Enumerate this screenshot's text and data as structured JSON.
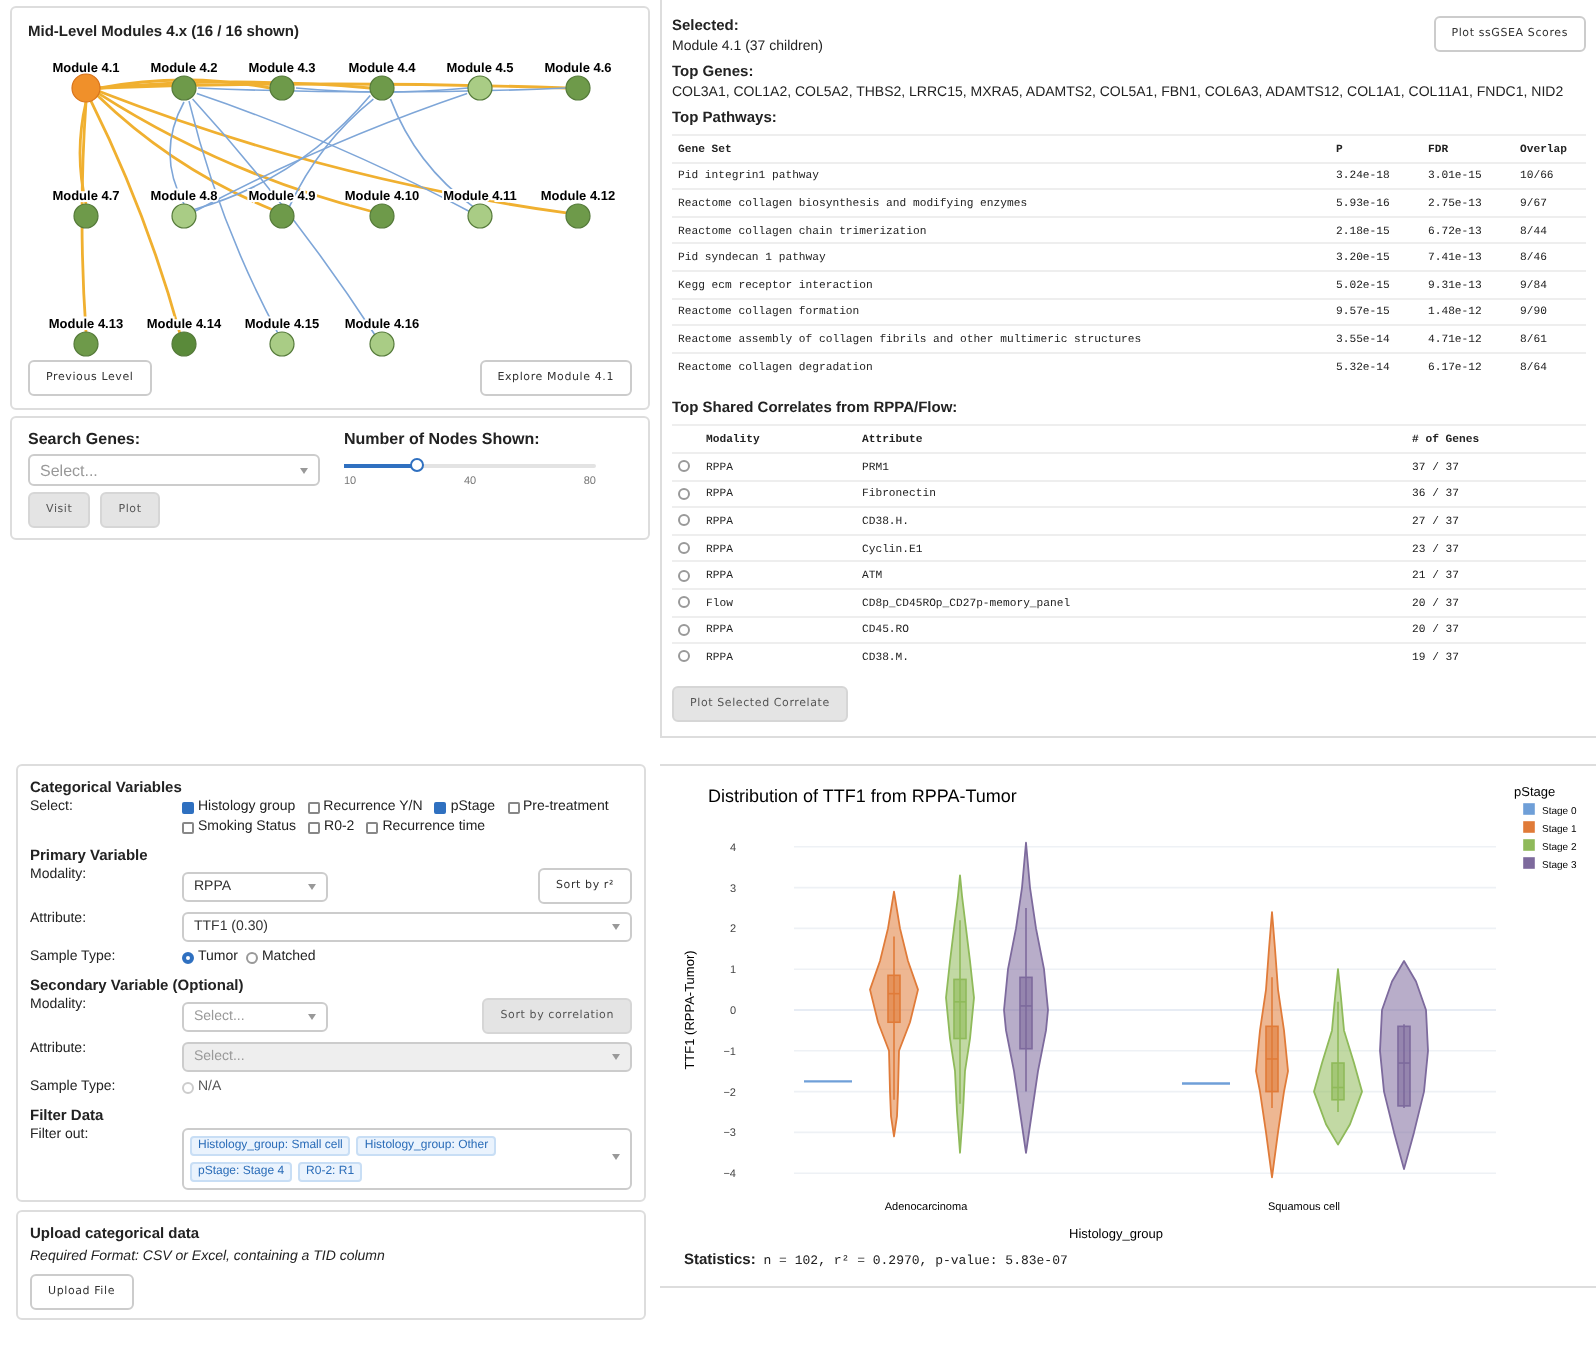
{
  "network": {
    "title": "Mid-Level Modules 4.x (16 / 16 shown)",
    "nodes": [
      {
        "label": "Module 4.1",
        "color": "#f0902a",
        "selected": true
      },
      {
        "label": "Module 4.2",
        "color": "#6e9a4a",
        "selected": false
      },
      {
        "label": "Module 4.3",
        "color": "#6e9a4a",
        "selected": false
      },
      {
        "label": "Module 4.4",
        "color": "#6e9a4a",
        "selected": false
      },
      {
        "label": "Module 4.5",
        "color": "#a9cc85",
        "selected": false
      },
      {
        "label": "Module 4.6",
        "color": "#6e9a4a",
        "selected": false
      },
      {
        "label": "Module 4.7",
        "color": "#6e9a4a",
        "selected": false
      },
      {
        "label": "Module 4.8",
        "color": "#a9cc85",
        "selected": false
      },
      {
        "label": "Module 4.9",
        "color": "#6e9a4a",
        "selected": false
      },
      {
        "label": "Module 4.10",
        "color": "#6e9a4a",
        "selected": false
      },
      {
        "label": "Module 4.11",
        "color": "#a9cc85",
        "selected": false
      },
      {
        "label": "Module 4.12",
        "color": "#6e9a4a",
        "selected": false
      },
      {
        "label": "Module 4.13",
        "color": "#6e9a4a",
        "selected": false
      },
      {
        "label": "Module 4.14",
        "color": "#5a8a3a",
        "selected": false
      },
      {
        "label": "Module 4.15",
        "color": "#a9cc85",
        "selected": false
      },
      {
        "label": "Module 4.16",
        "color": "#a9cc85",
        "selected": false
      }
    ],
    "buttons": [
      {
        "label": "Previous Level",
        "disabled": false
      },
      {
        "label": "Explore Module 4.1",
        "disabled": false
      }
    ]
  },
  "search": {
    "label": "Search Genes:",
    "field": {
      "placeholder": "Select..."
    },
    "buttons": [
      {
        "label": "Visit",
        "disabled": true
      },
      {
        "label": "Plot",
        "disabled": true
      }
    ],
    "slider": {
      "label": "Number of Nodes Shown:",
      "level": 0.29,
      "ticks": [
        "10",
        "40",
        "80"
      ]
    }
  },
  "selected": {
    "label": "Selected:",
    "value": "Module 4.1 (37 children)",
    "button": {
      "label": "Plot ssGSEA Scores",
      "disabled": false
    },
    "genes_label": "Top Genes:",
    "genes": "COL3A1, COL1A2, COL5A2, THBS2, LRRC15, MXRA5, ADAMTS2, COL5A1, FBN1, COL6A3, ADAMTS12, COL1A1, COL11A1, FNDC1, NID2",
    "pathways_label": "Top Pathways:",
    "pathways": {
      "columns": [
        "Gene Set",
        "P",
        "FDR",
        "Overlap"
      ],
      "rows": [
        [
          "Pid integrin1 pathway",
          "3.24e-18",
          "3.01e-15",
          "10/66"
        ],
        [
          "Reactome collagen biosynthesis and modifying enzymes",
          "5.93e-16",
          "2.75e-13",
          "9/67"
        ],
        [
          "Reactome collagen chain trimerization",
          "2.18e-15",
          "6.72e-13",
          "8/44"
        ],
        [
          "Pid syndecan 1 pathway",
          "3.20e-15",
          "7.41e-13",
          "8/46"
        ],
        [
          "Kegg ecm receptor interaction",
          "5.02e-15",
          "9.31e-13",
          "9/84"
        ],
        [
          "Reactome collagen formation",
          "9.57e-15",
          "1.48e-12",
          "9/90"
        ],
        [
          "Reactome assembly of collagen fibrils and other multimeric structures",
          "3.55e-14",
          "4.71e-12",
          "8/61"
        ],
        [
          "Reactome collagen degradation",
          "5.32e-14",
          "6.17e-12",
          "8/64"
        ]
      ]
    },
    "correlates_label": "Top Shared Correlates from RPPA/Flow:",
    "correlates": {
      "columns": [
        "Modality",
        "Attribute",
        "# of Genes"
      ],
      "rows": [
        {
          "cells": [
            "RPPA",
            "PRM1",
            "37 / 37"
          ],
          "selected": false
        },
        {
          "cells": [
            "RPPA",
            "Fibronectin",
            "36 / 37"
          ],
          "selected": false
        },
        {
          "cells": [
            "RPPA",
            "CD38.H.",
            "27 / 37"
          ],
          "selected": false
        },
        {
          "cells": [
            "RPPA",
            "Cyclin.E1",
            "23 / 37"
          ],
          "selected": false
        },
        {
          "cells": [
            "RPPA",
            "ATM",
            "21 / 37"
          ],
          "selected": false
        },
        {
          "cells": [
            "Flow",
            "CD8p_CD45ROp_CD27p-memory_panel",
            "20 / 37"
          ],
          "selected": false
        },
        {
          "cells": [
            "RPPA",
            "CD45.RO",
            "20 / 37"
          ],
          "selected": false
        },
        {
          "cells": [
            "RPPA",
            "CD38.M.",
            "19 / 37"
          ],
          "selected": false
        }
      ]
    },
    "plot_button": {
      "label": "Plot Selected Correlate",
      "disabled": true
    }
  },
  "categorical": {
    "title": "Categorical Variables",
    "label": "Select:",
    "options": [
      {
        "label": "Histology group",
        "checked": true
      },
      {
        "label": "Recurrence Y/N",
        "checked": false
      },
      {
        "label": "pStage",
        "checked": true
      },
      {
        "label": "Pre-treatment",
        "checked": false
      },
      {
        "label": "Smoking Status",
        "checked": false
      },
      {
        "label": "R0-2",
        "checked": false
      },
      {
        "label": "Recurrence time",
        "checked": false
      }
    ]
  },
  "primary": {
    "title": "Primary Variable",
    "modality_label": "Modality:",
    "modality": {
      "value": "RPPA",
      "disabled": false
    },
    "sort_button": {
      "label": "Sort by r²",
      "disabled": false
    },
    "attribute_label": "Attribute:",
    "attribute": {
      "value": "TTF1 (0.30)",
      "disabled": false
    },
    "sample_label": "Sample Type:",
    "sample_options": [
      {
        "label": "Tumor",
        "selected": true,
        "disabled": false
      },
      {
        "label": "Matched",
        "selected": false,
        "disabled": false
      }
    ]
  },
  "secondary": {
    "title": "Secondary Variable (Optional)",
    "modality_label": "Modality:",
    "modality": {
      "placeholder": "Select...",
      "disabled": false
    },
    "sort_button": {
      "label": "Sort by correlation",
      "disabled": true
    },
    "attribute_label": "Attribute:",
    "attribute": {
      "placeholder": "Select...",
      "disabled": true
    },
    "sample_label": "Sample Type:",
    "sample_options": [
      {
        "label": "N/A",
        "selected": false,
        "disabled": true
      }
    ]
  },
  "filter": {
    "title": "Filter Data",
    "label": "Filter out:",
    "tags": [
      "Histology_group: Small cell",
      "Histology_group: Other",
      "pStage: Stage 4",
      "R0-2: R1"
    ]
  },
  "upload": {
    "title": "Upload categorical data",
    "note": "Required Format: CSV or Excel, containing a TID column",
    "button": {
      "label": "Upload File",
      "disabled": false
    }
  },
  "chart": {
    "title": "Distribution of TTF1 from RPPA-Tumor",
    "ylabel": "TTF1 (RPPA-Tumor)",
    "xlabel": "Histology_group",
    "yticks": [
      "4",
      "3",
      "2",
      "1",
      "0",
      "−1",
      "−2",
      "−3",
      "−4"
    ],
    "categories": [
      "Adenocarcinoma",
      "Squamous cell"
    ],
    "legend": {
      "title": "pStage",
      "items": [
        {
          "label": "Stage 0",
          "color": "#6f9fd8"
        },
        {
          "label": "Stage 1",
          "color": "#e07b39"
        },
        {
          "label": "Stage 2",
          "color": "#8fba5a"
        },
        {
          "label": "Stage 3",
          "color": "#7d6a9d"
        }
      ]
    },
    "statistics": "**Statistics:** n = 102, r² = 0.2970, p-value: 5.83e-07"
  }
}
